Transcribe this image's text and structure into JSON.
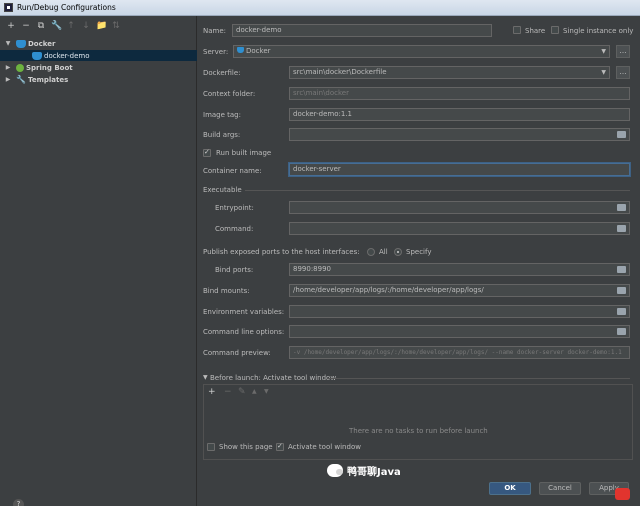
{
  "window": {
    "title": "Run/Debug Configurations"
  },
  "toolbar": [
    "+",
    "−",
    "⧉",
    "🔧",
    "↑",
    "↓",
    "📁",
    "⇅"
  ],
  "tree": {
    "docker_group": "Docker",
    "docker_item": "docker-demo",
    "spring_boot": "Spring Boot",
    "templates": "Templates"
  },
  "form": {
    "name_label": "Name:",
    "name_value": "docker-demo",
    "share_label": "Share",
    "single_instance_label": "Single instance only",
    "server_label": "Server:",
    "server_value": "Docker",
    "dockerfile_label": "Dockerfile:",
    "dockerfile_value": "src\\main\\docker\\Dockerfile",
    "context_label": "Context folder:",
    "context_value": "src\\main\\docker",
    "image_tag_label": "Image tag:",
    "image_tag_value": "docker-demo:1.1",
    "build_args_label": "Build args:",
    "run_built_image_label": "Run built image",
    "container_name_label": "Container name:",
    "container_name_value": "docker-server",
    "executable_label": "Executable",
    "entrypoint_label": "Entrypoint:",
    "command_label": "Command:",
    "publish_label": "Publish exposed ports to the host interfaces:",
    "all_label": "All",
    "specify_label": "Specify",
    "bind_ports_label": "Bind ports:",
    "bind_ports_value": "8990:8990",
    "bind_mounts_label": "Bind mounts:",
    "bind_mounts_value": "/home/developer/app/logs/:/home/developer/app/logs/",
    "env_vars_label": "Environment variables:",
    "cmd_options_label": "Command line options:",
    "cmd_preview_label": "Command preview:",
    "cmd_preview_value": "-v /home/developer/app/logs/:/home/developer/app/logs/ --name docker-server docker-demo:1.1"
  },
  "before_launch": {
    "title": "Before launch: Activate tool window",
    "empty_text": "There are no tasks to run before launch",
    "tools": [
      "+",
      "−",
      "✎",
      "▲",
      "▼"
    ]
  },
  "bottom": {
    "show_page_label": "Show this page",
    "activate_tool_window_label": "Activate tool window",
    "ok_label": "OK",
    "cancel_label": "Cancel",
    "apply_label": "Apply",
    "watermark_text": "鸭哥聊Java"
  },
  "colors": {
    "background": "#3c3f41",
    "selection": "#0d293e",
    "primary_button": "#365880",
    "docker_blue": "#2f8fd0",
    "spring_green": "#6db33f"
  }
}
